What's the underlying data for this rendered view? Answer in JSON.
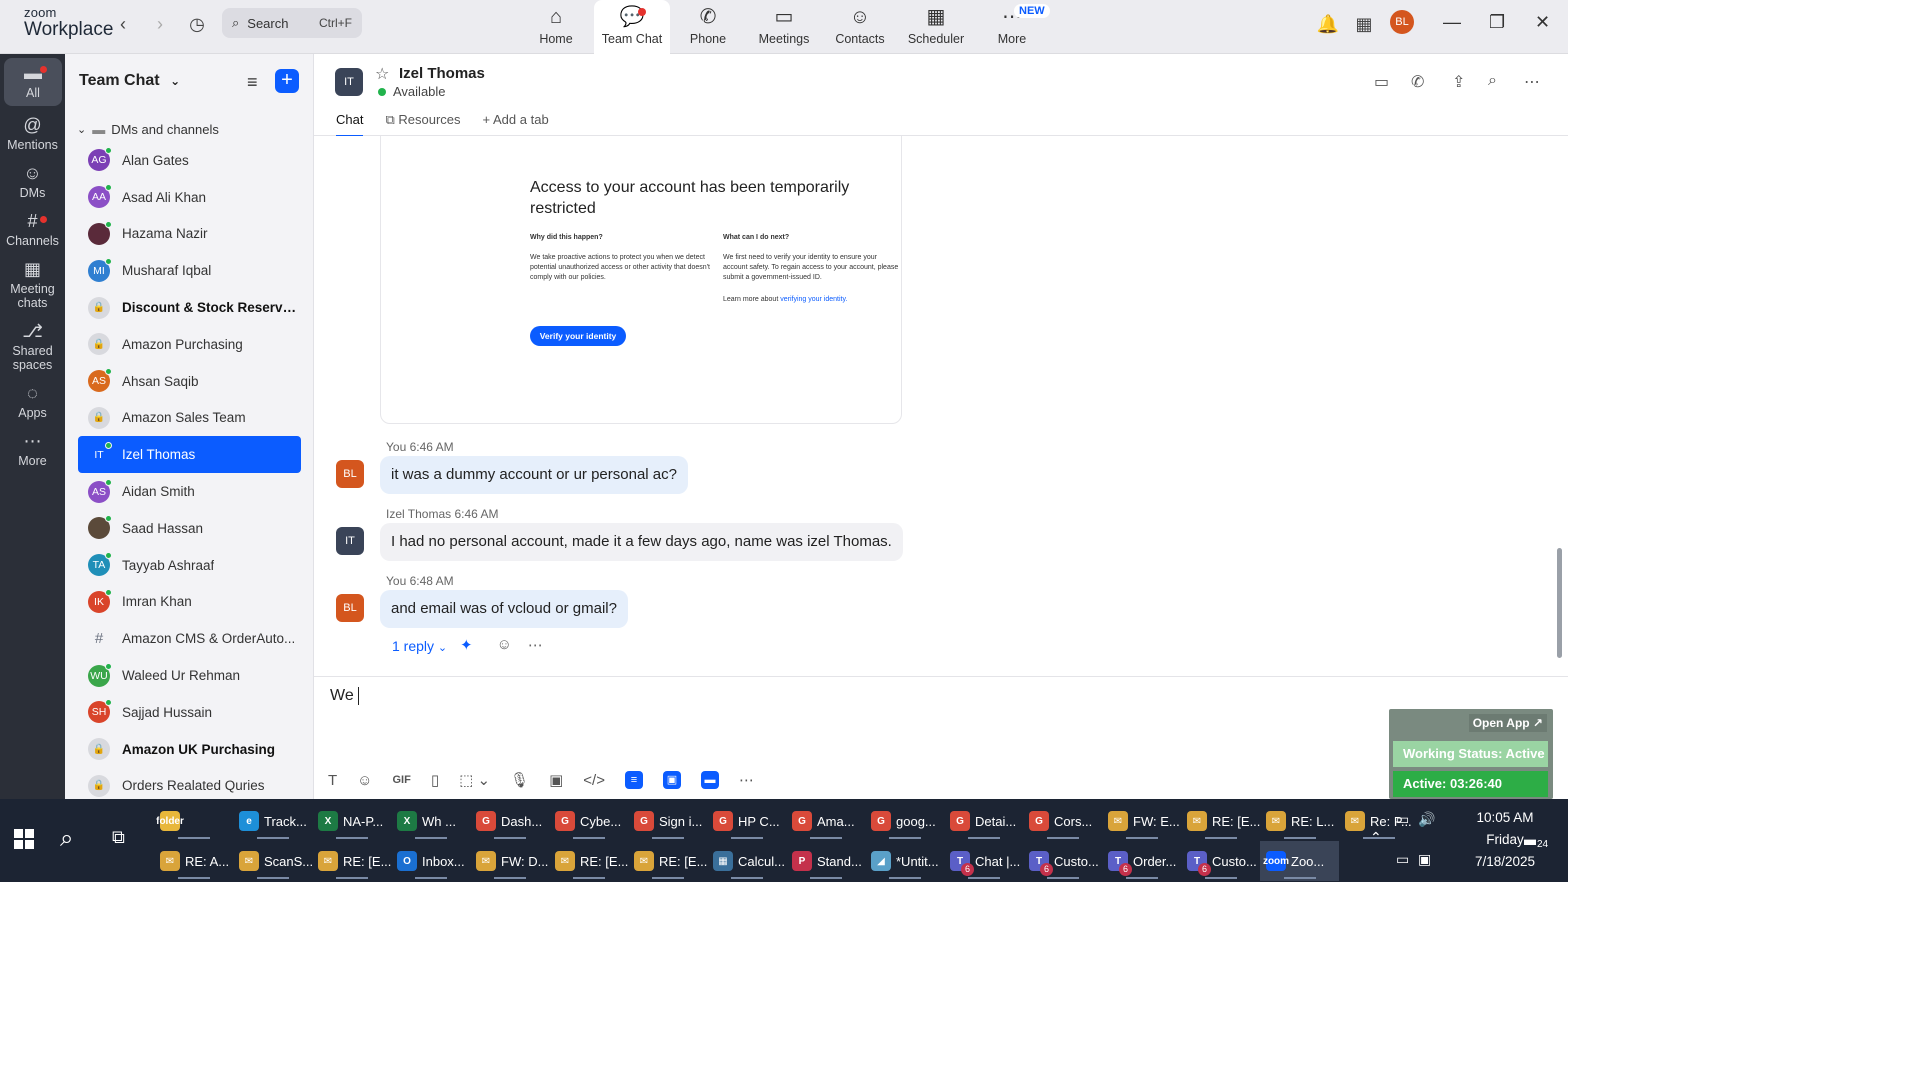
{
  "app": {
    "brand_top": "zoom",
    "brand_bottom": "Workplace"
  },
  "search": {
    "label": "Search",
    "shortcut": "Ctrl+F"
  },
  "nav": [
    {
      "label": "Home",
      "icon": "home-icon"
    },
    {
      "label": "Team Chat",
      "icon": "chat-icon",
      "active": true
    },
    {
      "label": "Phone",
      "icon": "phone-icon"
    },
    {
      "label": "Meetings",
      "icon": "video-icon"
    },
    {
      "label": "Contacts",
      "icon": "contacts-icon"
    },
    {
      "label": "Scheduler",
      "icon": "calendar-icon"
    },
    {
      "label": "More",
      "icon": "more-icon",
      "badge": "NEW"
    }
  ],
  "profile": {
    "initials": "BL"
  },
  "rail": [
    {
      "label": "All"
    },
    {
      "label": "Mentions"
    },
    {
      "label": "DMs"
    },
    {
      "label": "Channels"
    },
    {
      "label": "Meeting chats"
    },
    {
      "label": "Shared spaces"
    },
    {
      "label": "Apps"
    },
    {
      "label": "More"
    }
  ],
  "panel": {
    "title": "Team Chat",
    "section": "DMs and channels"
  },
  "contacts": [
    {
      "name": "Alan Gates",
      "initials": "AG",
      "color": "#7b3fb5",
      "type": "user"
    },
    {
      "name": "Asad Ali Khan",
      "initials": "AA",
      "color": "#8b4fc6",
      "type": "user"
    },
    {
      "name": "Hazama Nazir",
      "initials": "",
      "color": "#5a2a3a",
      "type": "user"
    },
    {
      "name": "Musharaf Iqbal",
      "initials": "MI",
      "color": "#2f7fd1",
      "type": "user"
    },
    {
      "name": "Discount & Stock Reserva...",
      "initials": "",
      "type": "lock",
      "bold": true
    },
    {
      "name": "Amazon Purchasing",
      "initials": "",
      "type": "lock"
    },
    {
      "name": "Ahsan Saqib",
      "initials": "AS",
      "color": "#d96a1e",
      "type": "user"
    },
    {
      "name": "Amazon Sales Team",
      "initials": "",
      "type": "lock"
    },
    {
      "name": "Izel Thomas",
      "initials": "IT",
      "color": "#3a4458",
      "type": "user",
      "selected": true
    },
    {
      "name": "Aidan Smith",
      "initials": "AS",
      "color": "#8b4fc6",
      "type": "user"
    },
    {
      "name": "Saad Hassan",
      "initials": "",
      "color": "#5b4a3a",
      "type": "user"
    },
    {
      "name": "Tayyab Ashraaf",
      "initials": "TA",
      "color": "#1f8fb8",
      "type": "user"
    },
    {
      "name": "Imran Khan",
      "initials": "IK",
      "color": "#d9442a",
      "type": "user"
    },
    {
      "name": "Amazon CMS & OrderAuto...",
      "initials": "",
      "type": "hash"
    },
    {
      "name": "Waleed Ur Rehman",
      "initials": "WU",
      "color": "#3aa64a",
      "type": "user"
    },
    {
      "name": "Sajjad Hussain",
      "initials": "SH",
      "color": "#d9442a",
      "type": "user"
    },
    {
      "name": "Amazon UK Purchasing",
      "initials": "",
      "type": "lock",
      "bold": true
    },
    {
      "name": "Orders Realated Quries",
      "initials": "",
      "type": "lock"
    }
  ],
  "chat": {
    "contact_name": "Izel Thomas",
    "contact_initials": "IT",
    "status": "Available",
    "tabs": [
      "Chat",
      "Resources",
      "Add a tab"
    ]
  },
  "card": {
    "heading": "Access to your account has been temporarily restricted",
    "col1_title": "Why did this happen?",
    "col1_body": "We take proactive actions to protect you when we detect potential unauthorized access or other activity that doesn't comply with our policies.",
    "col2_title": "What can I do next?",
    "col2_body": "We first need to verify your identity to ensure your account safety. To regain access to your account, please submit a government-issued ID.",
    "col2_learn": "Learn more about",
    "col2_link": "verifying your identity.",
    "button": "Verify your identity"
  },
  "messages": [
    {
      "sender": "You",
      "time": "6:46 AM",
      "initials": "BL",
      "text": "it was a dummy account or ur personal ac?"
    },
    {
      "sender": "Izel Thomas",
      "time": "6:46 AM",
      "initials": "IT",
      "text": "I had no personal account, made it a few days ago, name was izel Thomas."
    },
    {
      "sender": "You",
      "time": "6:48 AM",
      "initials": "BL",
      "text": "and email was of vcloud or gmail?"
    }
  ],
  "reply_label": "1 reply",
  "composer": {
    "text": "We"
  },
  "widget": {
    "open_app": "Open App ↗",
    "status": "Working Status: Active",
    "active": "Active: 03:26:40"
  },
  "taskbar_row1": [
    {
      "label": "",
      "icon": "folder",
      "color": "#e8b73a"
    },
    {
      "label": "Track...",
      "icon": "e",
      "color": "#1d8fd8"
    },
    {
      "label": "NA-P...",
      "icon": "X",
      "color": "#1d7a44"
    },
    {
      "label": "Wh ...",
      "icon": "X",
      "color": "#1d7a44"
    },
    {
      "label": "Dash...",
      "icon": "G",
      "color": "#d94a3a"
    },
    {
      "label": "Cybe...",
      "icon": "G",
      "color": "#d94a3a"
    },
    {
      "label": "Sign i...",
      "icon": "G",
      "color": "#d94a3a"
    },
    {
      "label": "HP C...",
      "icon": "G",
      "color": "#d94a3a"
    },
    {
      "label": "Ama...",
      "icon": "G",
      "color": "#d94a3a"
    },
    {
      "label": "goog...",
      "icon": "G",
      "color": "#d94a3a"
    },
    {
      "label": "Detai...",
      "icon": "G",
      "color": "#d94a3a"
    },
    {
      "label": "Cors...",
      "icon": "G",
      "color": "#d94a3a"
    },
    {
      "label": "FW: E...",
      "icon": "✉",
      "color": "#d9a43a"
    },
    {
      "label": "RE: [E...",
      "icon": "✉",
      "color": "#d9a43a"
    },
    {
      "label": "RE: L...",
      "icon": "✉",
      "color": "#d9a43a"
    },
    {
      "label": "Re: P...",
      "icon": "✉",
      "color": "#d9a43a"
    }
  ],
  "taskbar_row2": [
    {
      "label": "RE: A...",
      "icon": "✉",
      "color": "#d9a43a"
    },
    {
      "label": "ScanS...",
      "icon": "✉",
      "color": "#d9a43a"
    },
    {
      "label": "RE: [E...",
      "icon": "✉",
      "color": "#d9a43a"
    },
    {
      "label": "Inbox...",
      "icon": "O",
      "color": "#1a6fd1"
    },
    {
      "label": "FW: D...",
      "icon": "✉",
      "color": "#d9a43a"
    },
    {
      "label": "RE: [E...",
      "icon": "✉",
      "color": "#d9a43a"
    },
    {
      "label": "RE: [E...",
      "icon": "✉",
      "color": "#d9a43a"
    },
    {
      "label": "Calcul...",
      "icon": "▦",
      "color": "#3a6f9a"
    },
    {
      "label": "Stand...",
      "icon": "P",
      "color": "#c4314b"
    },
    {
      "label": "*Untit...",
      "icon": "◢",
      "color": "#5aa0c8"
    },
    {
      "label": "Chat |...",
      "icon": "T",
      "color": "#5b5fc7",
      "count": "6"
    },
    {
      "label": "Custo...",
      "icon": "T",
      "color": "#5b5fc7",
      "count": "6"
    },
    {
      "label": "Order...",
      "icon": "T",
      "color": "#5b5fc7",
      "count": "6"
    },
    {
      "label": "Custo...",
      "icon": "T",
      "color": "#5b5fc7",
      "count": "6"
    },
    {
      "label": "Zoo...",
      "icon": "zoom",
      "color": "#0b5cff",
      "active": true
    }
  ],
  "clock": {
    "time": "10:05 AM",
    "day": "Friday",
    "date": "7/18/2025",
    "notifications": "24"
  }
}
